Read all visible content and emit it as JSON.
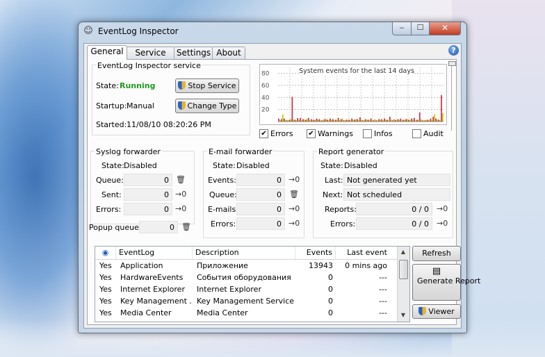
{
  "window": {
    "title": "EventLog Inspector",
    "min": "‒",
    "max": "☐",
    "close": "✕"
  },
  "tabs": [
    {
      "label": "General"
    },
    {
      "label": "Service Log"
    },
    {
      "label": "Settings"
    },
    {
      "label": "About"
    }
  ],
  "help": "?",
  "service": {
    "title": "EventLog Inspector service",
    "state_label": "State:",
    "state_value": "Running",
    "state_color": "#1e9a1e",
    "startup_label": "Startup:",
    "startup_value": "Manual",
    "started_label": "Started:",
    "started_value": "11/08/10 08:20:26 PM",
    "stop_button": "Stop Service",
    "change_button": "Change Type"
  },
  "chart_data": {
    "type": "bar",
    "title": "System events for the last 14 days",
    "ylim": [
      0,
      90
    ],
    "yticks": [
      20,
      40,
      60,
      80
    ],
    "grid": true,
    "series": [
      {
        "name": "Errors",
        "color": "#cc3344",
        "values": [
          5,
          4,
          5,
          2,
          3,
          41,
          3,
          6,
          6,
          4,
          3,
          6,
          4,
          3,
          5,
          4,
          2,
          4,
          3,
          5,
          4,
          3,
          6,
          4,
          2,
          3,
          3,
          5,
          3,
          4,
          7,
          2,
          4,
          3,
          5,
          2,
          2,
          4,
          4,
          5,
          3,
          8,
          2,
          3,
          4,
          5,
          3,
          4,
          3,
          5,
          6,
          3,
          15,
          2,
          2,
          3,
          5,
          8,
          5,
          3,
          44
        ]
      },
      {
        "name": "Warnings",
        "color": "#c8c800",
        "values": [
          2,
          12,
          3,
          2,
          4,
          3,
          2,
          3,
          2,
          3,
          4,
          2,
          3,
          2,
          3,
          2,
          3,
          4,
          2,
          3,
          2,
          3,
          2,
          5,
          2,
          3,
          2,
          3,
          4,
          2,
          3,
          2,
          3,
          2,
          3,
          4,
          2,
          3,
          2,
          3,
          2,
          3,
          4,
          2,
          3,
          2,
          3,
          4,
          2,
          3,
          2,
          3,
          4,
          2,
          3,
          2,
          3,
          12,
          3,
          2,
          14
        ]
      }
    ]
  },
  "filters": [
    {
      "label": "Errors",
      "checked": true
    },
    {
      "label": "Warnings",
      "checked": true
    },
    {
      "label": "Infos",
      "checked": false
    },
    {
      "label": "Audit",
      "checked": false
    }
  ],
  "syslog": {
    "title": "Syslog forwarder",
    "state_label": "State:",
    "state_value": "Disabled",
    "queue_label": "Queue:",
    "queue": "0",
    "sent_label": "Sent:",
    "sent": "0",
    "errors_label": "Errors:",
    "errors": "0"
  },
  "email": {
    "title": "E-mail forwarder",
    "state_label": "State:",
    "state_value": "Disabled",
    "events_label": "Events:",
    "events": "0",
    "queue_label": "Queue:",
    "queue": "0",
    "emails_label": "E-mails:",
    "emails": "0",
    "errors_label": "Errors:",
    "errors": "0"
  },
  "report": {
    "title": "Report generator",
    "state_label": "State:",
    "state_value": "Disabled",
    "last_label": "Last:",
    "last_value": "Not generated yet",
    "next_label": "Next:",
    "next_value": "Not scheduled",
    "reports_label": "Reports:",
    "reports": "0 / 0",
    "errors_label": "Errors:",
    "errors": "0 / 0"
  },
  "popup": {
    "label": "Popup queue:",
    "value": "0"
  },
  "icons": {
    "trash": "🗑",
    "forward": "→0"
  },
  "table": {
    "columns": [
      "EventLog",
      "Description",
      "Events",
      "Last event"
    ],
    "rows": [
      {
        "visible": "Yes",
        "eventlog": "Application",
        "description": "Приложение",
        "events": "13943",
        "last": "0 mins ago"
      },
      {
        "visible": "Yes",
        "eventlog": "HardwareEvents",
        "description": "События оборудования",
        "events": "0",
        "last": "---"
      },
      {
        "visible": "Yes",
        "eventlog": "Internet Explorer",
        "description": "Internet Explorer",
        "events": "0",
        "last": "---"
      },
      {
        "visible": "Yes",
        "eventlog": "Key Management ...",
        "description": "Key Management Service",
        "events": "0",
        "last": "---"
      },
      {
        "visible": "Yes",
        "eventlog": "Media Center",
        "description": "Media Center",
        "events": "0",
        "last": "---"
      }
    ]
  },
  "buttons": {
    "refresh": "Refresh",
    "generate_report": "Generate Report",
    "viewer": "Viewer"
  }
}
